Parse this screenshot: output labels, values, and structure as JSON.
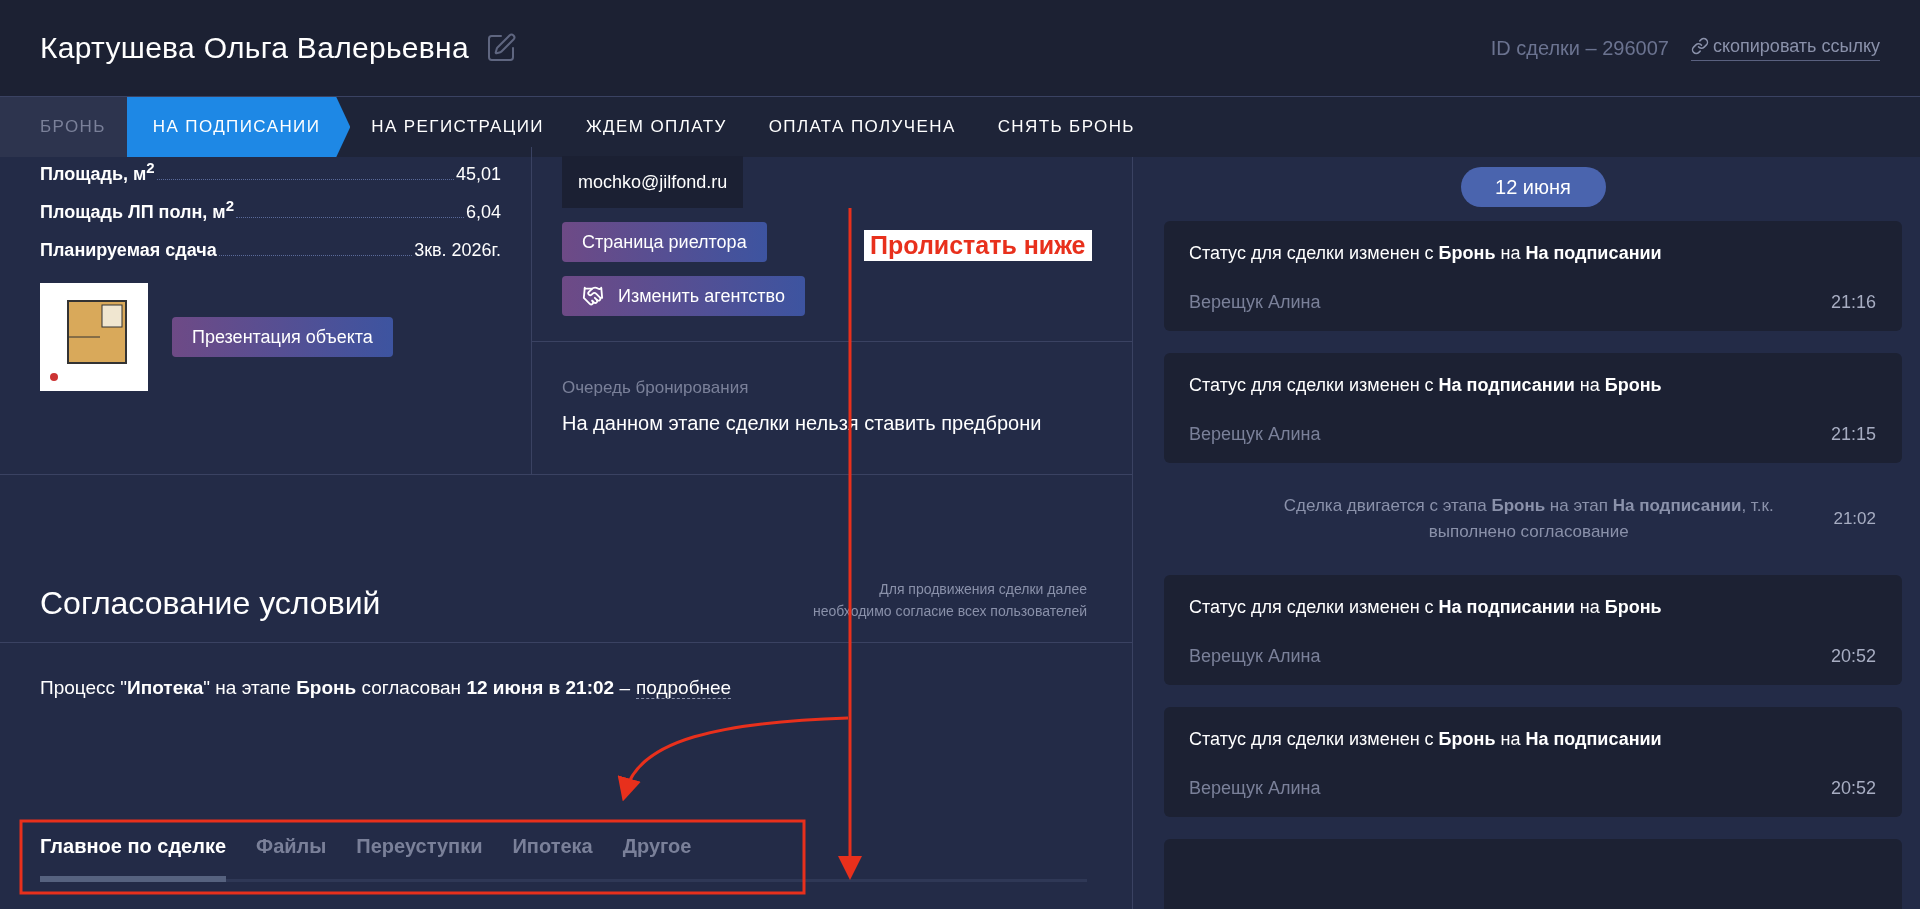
{
  "header": {
    "title": "Картушева Ольга Валерьевна",
    "deal_id": "ID сделки – 296007",
    "copy_link": "скопировать ссылку"
  },
  "stages": [
    {
      "label": "БРОНЬ",
      "done": true,
      "selected": false
    },
    {
      "label": "НА ПОДПИСАНИИ",
      "done": false,
      "selected": true
    },
    {
      "label": "НА РЕГИСТРАЦИИ",
      "done": false,
      "selected": false
    },
    {
      "label": "ЖДЕМ ОПЛАТУ",
      "done": false,
      "selected": false
    },
    {
      "label": "ОПЛАТА ПОЛУЧЕНА",
      "done": false,
      "selected": false
    },
    {
      "label": "СНЯТЬ БРОНЬ",
      "done": false,
      "selected": false
    }
  ],
  "object": {
    "rows": [
      {
        "label": "Площадь, м$^{2}$",
        "value": "45,01"
      },
      {
        "label": "Площадь ЛП полн, м$^{2}$",
        "value": "6,04"
      },
      {
        "label": "Планируемая сдача",
        "value": "3кв. 2026г."
      }
    ],
    "presentation_button": "Презентация объекта"
  },
  "realtor": {
    "email": "mochko@jilfond.ru",
    "page_button": "Страница риелтора",
    "agency_button": "Изменить агентство"
  },
  "queue": {
    "label": "Очередь бронирования",
    "text": "На данном этапе сделки нельзя ставить предброни"
  },
  "approval": {
    "title": "Согласование условий",
    "note": [
      "Для продвижения сделки далее",
      "необходимо согласие всех пользователей"
    ],
    "text": "Процесс \"**Ипотека**\" на этапе **Бронь** согласован **12 июня в 21:02** –",
    "link": "подробнее"
  },
  "tabs": [
    {
      "label": "Главное по сделке",
      "selected": true
    },
    {
      "label": "Файлы",
      "selected": false
    },
    {
      "label": "Переуступки",
      "selected": false
    },
    {
      "label": "Ипотека",
      "selected": false
    },
    {
      "label": "Другое",
      "selected": false
    }
  ],
  "feed": {
    "date": "12 июня",
    "items": [
      {
        "kind": "status",
        "text": "Статус для сделки изменен с **Бронь** на **На подписании**",
        "author": "Верещук Алина",
        "time": "21:16"
      },
      {
        "kind": "status",
        "text": "Статус для сделки изменен с **На подписании** на **Бронь**",
        "author": "Верещук Алина",
        "time": "21:15"
      },
      {
        "kind": "system",
        "text": "Сделка двигается с этапа **Бронь** на этап **На подписании**, т.к. выполнено согласование",
        "time": "21:02"
      },
      {
        "kind": "status",
        "text": "Статус для сделки изменен с **На подписании** на **Бронь**",
        "author": "Верещук Алина",
        "time": "20:52"
      },
      {
        "kind": "status",
        "text": "Статус для сделки изменен с **Бронь** на **На подписании**",
        "author": "Верещук Алина",
        "time": "20:52"
      }
    ]
  },
  "annotation": {
    "label": "Пролистать ниже"
  }
}
